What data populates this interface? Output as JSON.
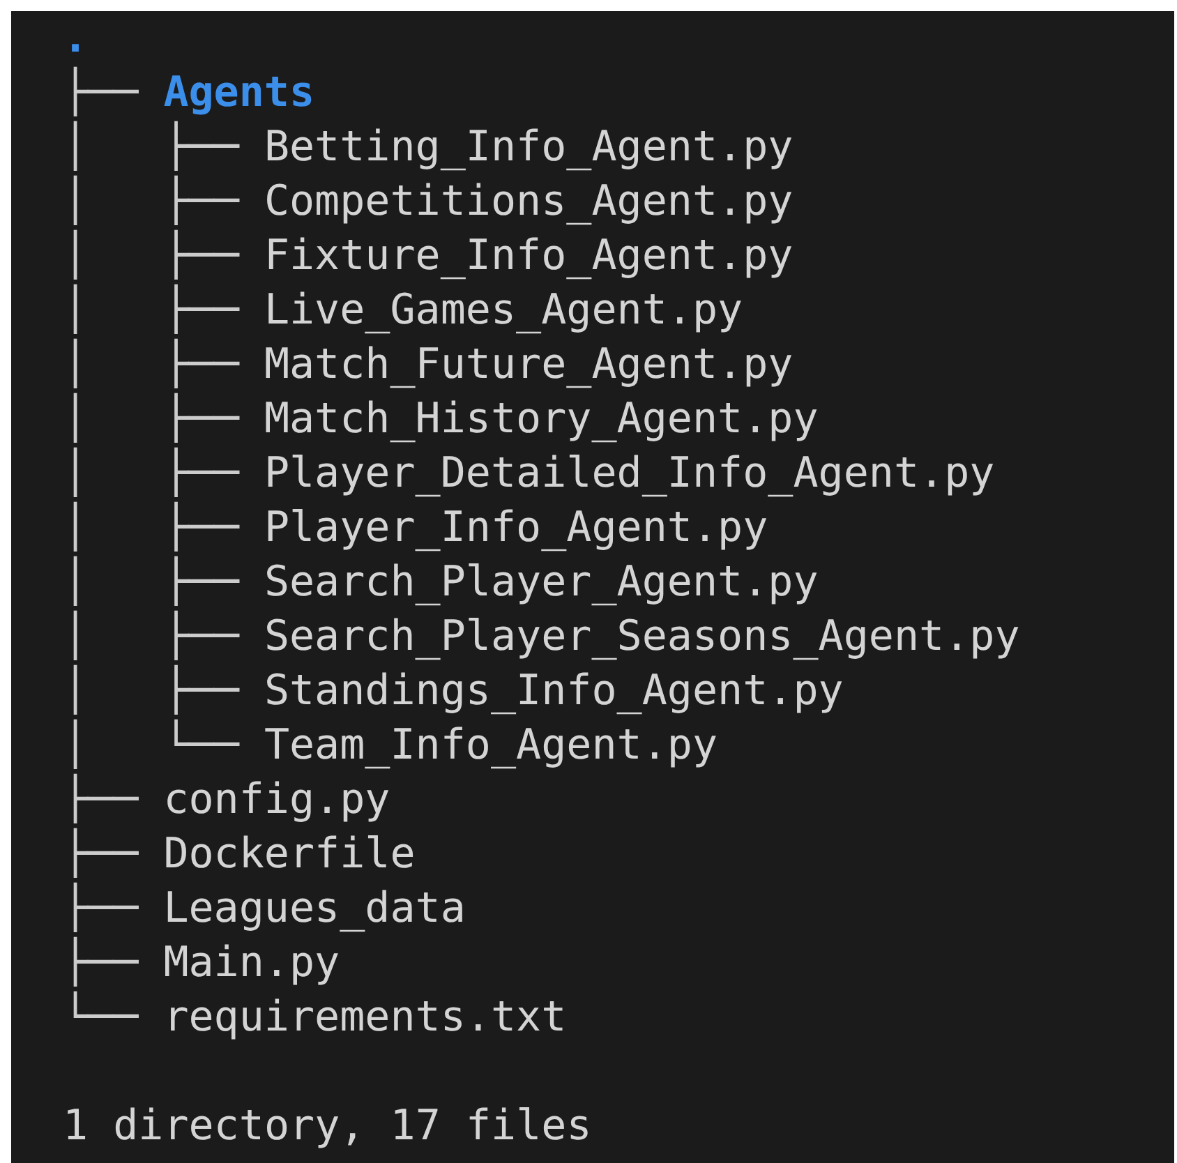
{
  "tree": {
    "label": ".",
    "children": [
      {
        "prefix": "├──",
        "label": "Agents",
        "children": [
          {
            "prefix": "│   ├──",
            "label": "Betting_Info_Agent.py"
          },
          {
            "prefix": "│   ├──",
            "label": "Competitions_Agent.py"
          },
          {
            "prefix": "│   ├──",
            "label": "Fixture_Info_Agent.py"
          },
          {
            "prefix": "│   ├──",
            "label": "Live_Games_Agent.py"
          },
          {
            "prefix": "│   ├──",
            "label": "Match_Future_Agent.py"
          },
          {
            "prefix": "│   ├──",
            "label": "Match_History_Agent.py"
          },
          {
            "prefix": "│   ├──",
            "label": "Player_Detailed_Info_Agent.py"
          },
          {
            "prefix": "│   ├──",
            "label": "Player_Info_Agent.py"
          },
          {
            "prefix": "│   ├──",
            "label": "Search_Player_Agent.py"
          },
          {
            "prefix": "│   ├──",
            "label": "Search_Player_Seasons_Agent.py"
          },
          {
            "prefix": "│   ├──",
            "label": "Standings_Info_Agent.py"
          },
          {
            "prefix": "│   └──",
            "label": "Team_Info_Agent.py"
          }
        ]
      },
      {
        "prefix": "├──",
        "label": "config.py"
      },
      {
        "prefix": "├──",
        "label": "Dockerfile"
      },
      {
        "prefix": "├──",
        "label": "Leagues_data"
      },
      {
        "prefix": "├──",
        "label": "Main.py"
      },
      {
        "prefix": "└──",
        "label": "requirements.txt"
      }
    ]
  },
  "summary": "1 directory, 17 files"
}
